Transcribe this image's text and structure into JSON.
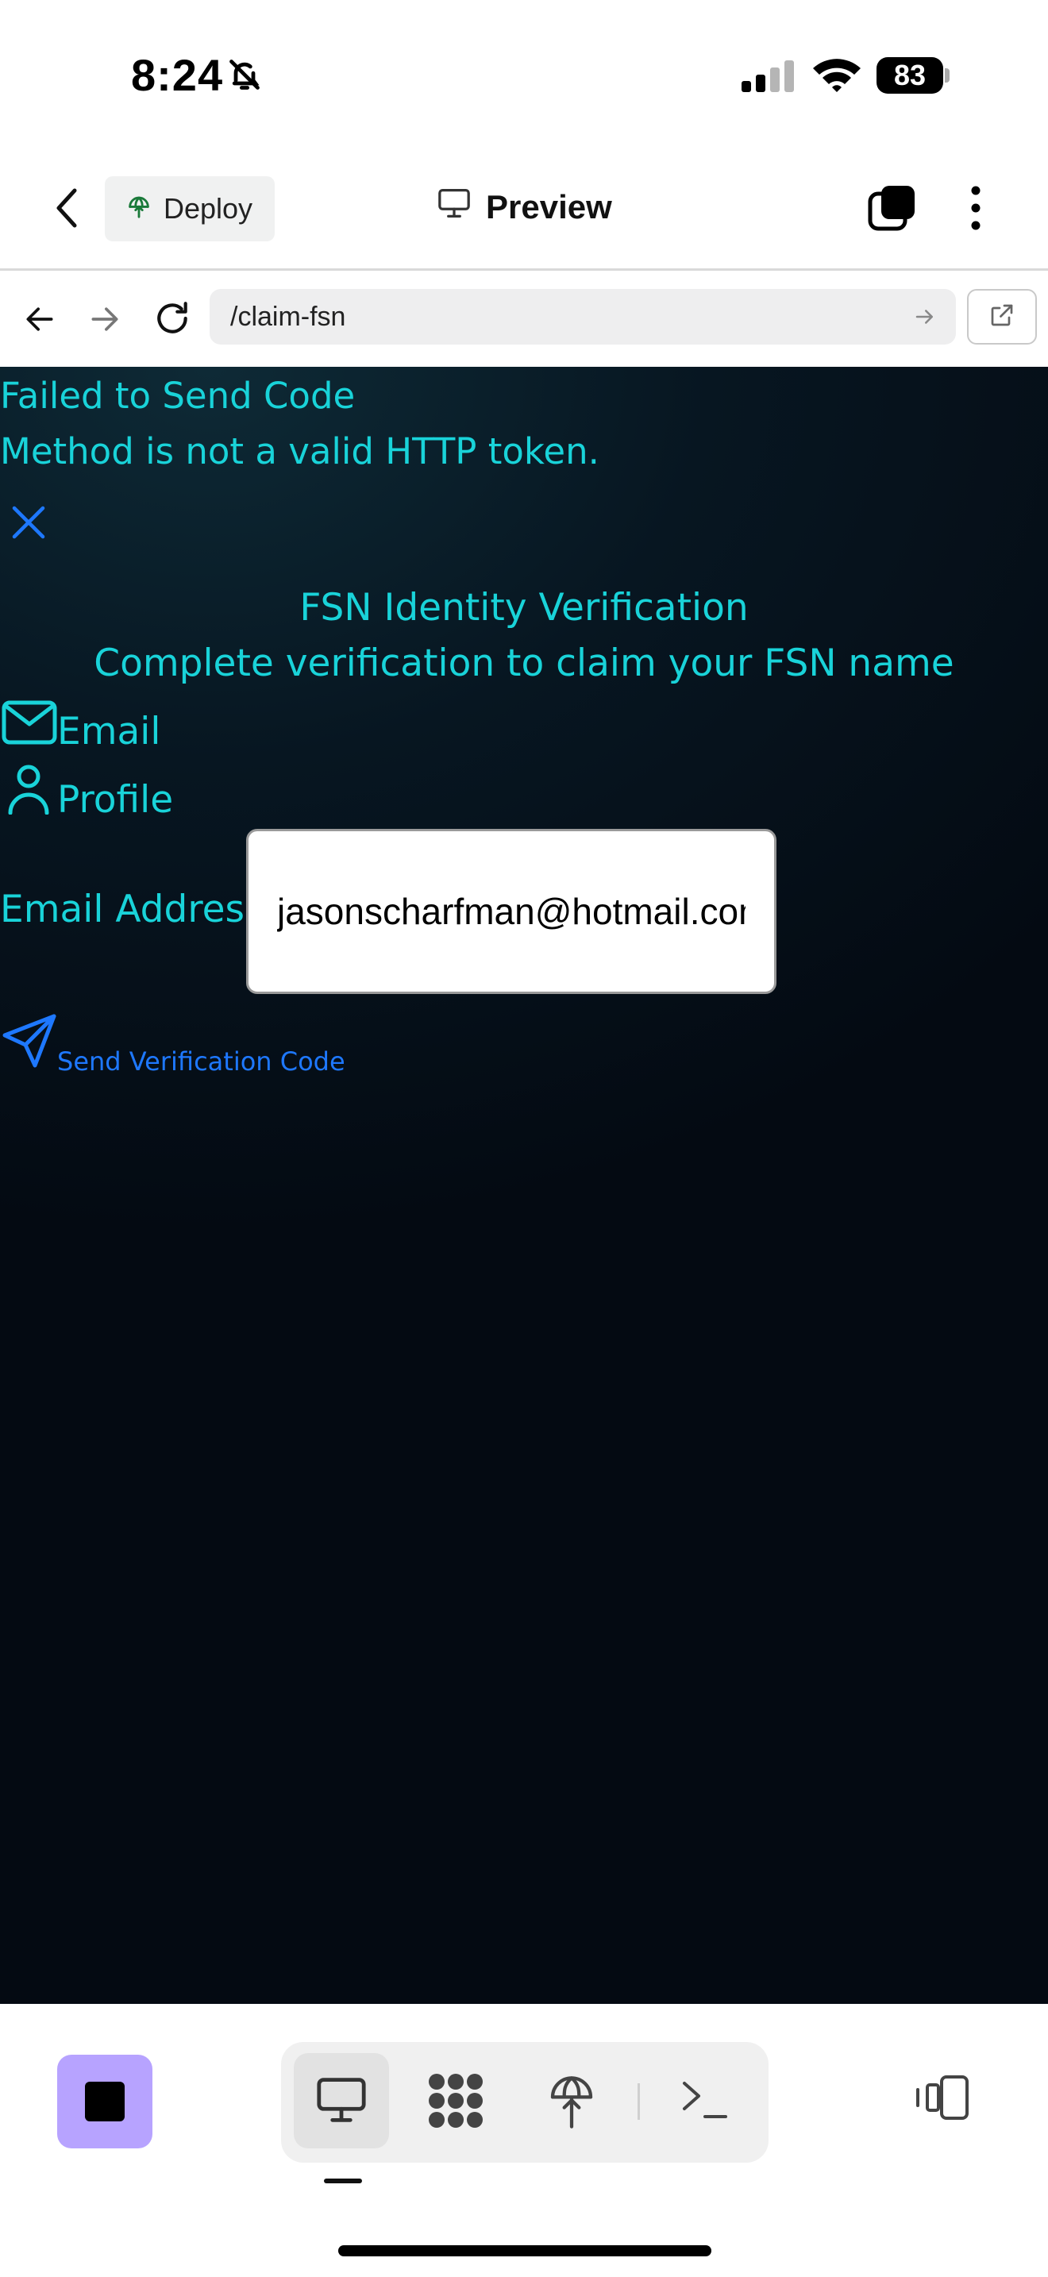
{
  "status_bar": {
    "time": "8:24",
    "battery": "83"
  },
  "header": {
    "deploy_label": "Deploy",
    "preview_label": "Preview"
  },
  "browser": {
    "url": "/claim-fsn"
  },
  "content": {
    "error_title": "Failed to Send Code",
    "error_message": "Method is not a valid HTTP token.",
    "title": "FSN Identity Verification",
    "subtitle": "Complete verification to claim your FSN name",
    "tabs": [
      {
        "label": "Email",
        "icon": "mail-icon"
      },
      {
        "label": "Profile",
        "icon": "user-icon"
      }
    ],
    "email_label": "Email Address",
    "email_value": "jasonscharfman@hotmail.com",
    "send_label": "Send Verification Code"
  },
  "colors": {
    "accent_cyan": "#19d3d9",
    "link_blue": "#1e78ff",
    "stop_purple": "#b7a3ff"
  }
}
